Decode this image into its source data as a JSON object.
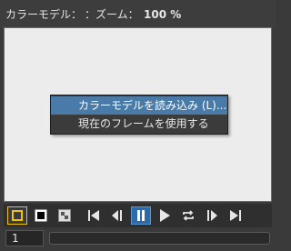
{
  "header": {
    "color_model_label": "カラーモデル：",
    "zoom_label": "：ズーム：",
    "zoom_value": "100 %"
  },
  "context_menu": {
    "items": [
      {
        "label": "カラーモデルを読み込み (L)...",
        "highlighted": true
      },
      {
        "label": "現在のフレームを使用する",
        "highlighted": false
      }
    ]
  },
  "toolbar": {
    "buttons": [
      {
        "icon": "foreground-swatch-icon",
        "active": true
      },
      {
        "icon": "background-swatch-icon"
      },
      {
        "icon": "checkerboard-icon"
      },
      {
        "icon": "first-frame-icon"
      },
      {
        "icon": "previous-frame-icon"
      },
      {
        "icon": "pause-icon",
        "active": true
      },
      {
        "icon": "play-icon"
      },
      {
        "icon": "loop-icon"
      },
      {
        "icon": "next-frame-icon"
      },
      {
        "icon": "last-frame-icon"
      }
    ]
  },
  "frame": {
    "current": "1"
  },
  "colors": {
    "accent": "#4a7aa8",
    "active_outline": "#f0c500",
    "canvas": "#ececec"
  }
}
